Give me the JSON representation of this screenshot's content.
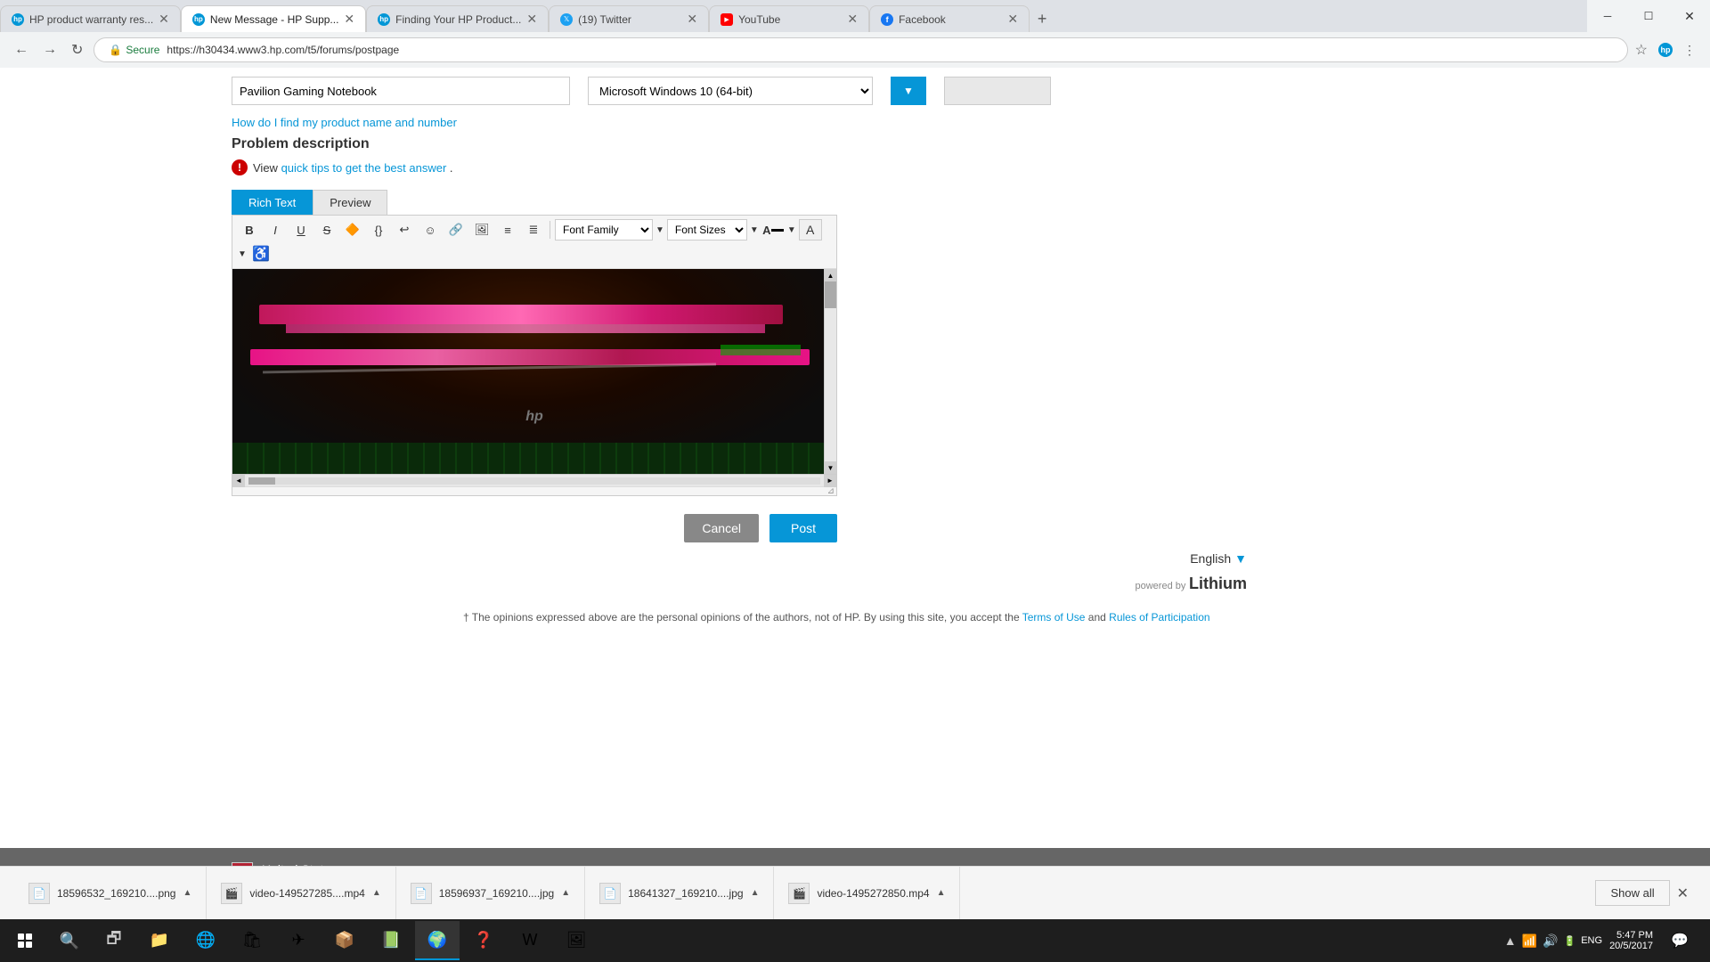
{
  "browser": {
    "tabs": [
      {
        "id": "tab1",
        "title": "HP product warranty res...",
        "favicon_type": "hp",
        "active": false
      },
      {
        "id": "tab2",
        "title": "New Message - HP Supp...",
        "favicon_type": "hp",
        "active": true
      },
      {
        "id": "tab3",
        "title": "Finding Your HP Product...",
        "favicon_type": "hp",
        "active": false
      },
      {
        "id": "tab4",
        "title": "(19) Twitter",
        "favicon_type": "twitter",
        "active": false
      },
      {
        "id": "tab5",
        "title": "YouTube",
        "favicon_type": "youtube",
        "active": false
      },
      {
        "id": "tab6",
        "title": "Facebook",
        "favicon_type": "fb",
        "active": false
      }
    ],
    "address": "https://h30434.www3.hp.com/t5/forums/postpage",
    "secure_label": "Secure"
  },
  "page": {
    "product_input_value": "Pavilion Gaming Notebook",
    "os_value": "Microsoft Windows 10 (64-bit)",
    "find_product_link": "How do I find my product name and number",
    "problem_description_label": "Problem description",
    "view_label": "View",
    "quick_tips_link": "quick tips to get the best answer",
    "tips_period": ".",
    "editor": {
      "tab_rich_text": "Rich Text",
      "tab_preview": "Preview",
      "toolbar_buttons": [
        "B",
        "I",
        "U",
        "S",
        "🔥",
        "{}",
        "↩",
        "☺",
        "🔗",
        "🖼",
        "≡",
        "≣"
      ],
      "font_family_label": "Font Family",
      "font_sizes_label": "Font Sizes"
    },
    "cancel_btn": "Cancel",
    "post_btn": "Post",
    "language": "English",
    "powered_by_text": "powered by",
    "lithium_text": "Lithium",
    "disclaimer": "† The opinions expressed above are the personal opinions of the authors, not of HP. By using this site, you accept the",
    "terms_link": "Terms of Use",
    "and_text": "and",
    "rules_link": "Rules of Participation",
    "country": "United States"
  },
  "downloads_bar": {
    "items": [
      {
        "name": "18596532_169210....png",
        "icon": "📄"
      },
      {
        "name": "video-149527285....mp4",
        "icon": "🎬"
      },
      {
        "name": "18596937_169210....jpg",
        "icon": "📄"
      },
      {
        "name": "18641327_169210....jpg",
        "icon": "📄"
      },
      {
        "name": "video-1495272850.mp4",
        "icon": "🎬"
      }
    ],
    "show_all_label": "Show all"
  },
  "taskbar": {
    "time": "5:47 PM",
    "date": "20/5/2017",
    "lang": "ENG"
  }
}
